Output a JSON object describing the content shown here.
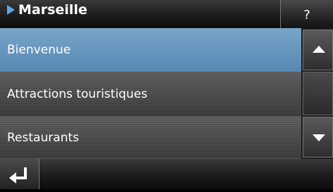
{
  "header": {
    "title": "Marseille",
    "help_label": "?"
  },
  "list": {
    "items": [
      {
        "label": "Bienvenue",
        "selected": true
      },
      {
        "label": "Attractions touristiques",
        "selected": false
      },
      {
        "label": "Restaurants",
        "selected": false
      }
    ]
  },
  "icons": {
    "title": "play-arrow-icon",
    "scroll_up": "triangle-up-icon",
    "scroll_down": "triangle-down-icon",
    "back": "return-arrow-icon"
  },
  "colors": {
    "selected_item": "#5688b3",
    "title_arrow": "#5aa8e8"
  }
}
